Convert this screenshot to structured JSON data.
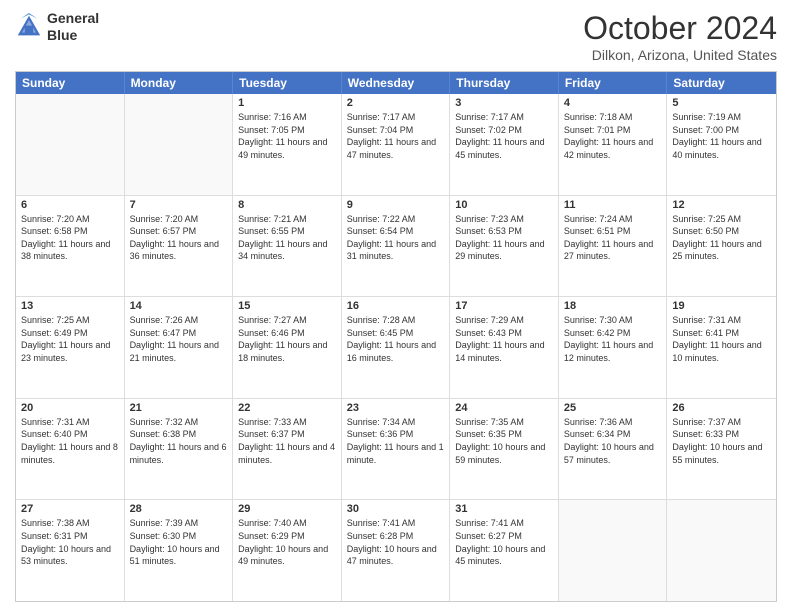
{
  "logo": {
    "line1": "General",
    "line2": "Blue"
  },
  "title": "October 2024",
  "location": "Dilkon, Arizona, United States",
  "days_header": [
    "Sunday",
    "Monday",
    "Tuesday",
    "Wednesday",
    "Thursday",
    "Friday",
    "Saturday"
  ],
  "weeks": [
    [
      {
        "day": "",
        "empty": true
      },
      {
        "day": "",
        "empty": true
      },
      {
        "day": "1",
        "sunrise": "Sunrise: 7:16 AM",
        "sunset": "Sunset: 7:05 PM",
        "daylight": "Daylight: 11 hours and 49 minutes."
      },
      {
        "day": "2",
        "sunrise": "Sunrise: 7:17 AM",
        "sunset": "Sunset: 7:04 PM",
        "daylight": "Daylight: 11 hours and 47 minutes."
      },
      {
        "day": "3",
        "sunrise": "Sunrise: 7:17 AM",
        "sunset": "Sunset: 7:02 PM",
        "daylight": "Daylight: 11 hours and 45 minutes."
      },
      {
        "day": "4",
        "sunrise": "Sunrise: 7:18 AM",
        "sunset": "Sunset: 7:01 PM",
        "daylight": "Daylight: 11 hours and 42 minutes."
      },
      {
        "day": "5",
        "sunrise": "Sunrise: 7:19 AM",
        "sunset": "Sunset: 7:00 PM",
        "daylight": "Daylight: 11 hours and 40 minutes."
      }
    ],
    [
      {
        "day": "6",
        "sunrise": "Sunrise: 7:20 AM",
        "sunset": "Sunset: 6:58 PM",
        "daylight": "Daylight: 11 hours and 38 minutes."
      },
      {
        "day": "7",
        "sunrise": "Sunrise: 7:20 AM",
        "sunset": "Sunset: 6:57 PM",
        "daylight": "Daylight: 11 hours and 36 minutes."
      },
      {
        "day": "8",
        "sunrise": "Sunrise: 7:21 AM",
        "sunset": "Sunset: 6:55 PM",
        "daylight": "Daylight: 11 hours and 34 minutes."
      },
      {
        "day": "9",
        "sunrise": "Sunrise: 7:22 AM",
        "sunset": "Sunset: 6:54 PM",
        "daylight": "Daylight: 11 hours and 31 minutes."
      },
      {
        "day": "10",
        "sunrise": "Sunrise: 7:23 AM",
        "sunset": "Sunset: 6:53 PM",
        "daylight": "Daylight: 11 hours and 29 minutes."
      },
      {
        "day": "11",
        "sunrise": "Sunrise: 7:24 AM",
        "sunset": "Sunset: 6:51 PM",
        "daylight": "Daylight: 11 hours and 27 minutes."
      },
      {
        "day": "12",
        "sunrise": "Sunrise: 7:25 AM",
        "sunset": "Sunset: 6:50 PM",
        "daylight": "Daylight: 11 hours and 25 minutes."
      }
    ],
    [
      {
        "day": "13",
        "sunrise": "Sunrise: 7:25 AM",
        "sunset": "Sunset: 6:49 PM",
        "daylight": "Daylight: 11 hours and 23 minutes."
      },
      {
        "day": "14",
        "sunrise": "Sunrise: 7:26 AM",
        "sunset": "Sunset: 6:47 PM",
        "daylight": "Daylight: 11 hours and 21 minutes."
      },
      {
        "day": "15",
        "sunrise": "Sunrise: 7:27 AM",
        "sunset": "Sunset: 6:46 PM",
        "daylight": "Daylight: 11 hours and 18 minutes."
      },
      {
        "day": "16",
        "sunrise": "Sunrise: 7:28 AM",
        "sunset": "Sunset: 6:45 PM",
        "daylight": "Daylight: 11 hours and 16 minutes."
      },
      {
        "day": "17",
        "sunrise": "Sunrise: 7:29 AM",
        "sunset": "Sunset: 6:43 PM",
        "daylight": "Daylight: 11 hours and 14 minutes."
      },
      {
        "day": "18",
        "sunrise": "Sunrise: 7:30 AM",
        "sunset": "Sunset: 6:42 PM",
        "daylight": "Daylight: 11 hours and 12 minutes."
      },
      {
        "day": "19",
        "sunrise": "Sunrise: 7:31 AM",
        "sunset": "Sunset: 6:41 PM",
        "daylight": "Daylight: 11 hours and 10 minutes."
      }
    ],
    [
      {
        "day": "20",
        "sunrise": "Sunrise: 7:31 AM",
        "sunset": "Sunset: 6:40 PM",
        "daylight": "Daylight: 11 hours and 8 minutes."
      },
      {
        "day": "21",
        "sunrise": "Sunrise: 7:32 AM",
        "sunset": "Sunset: 6:38 PM",
        "daylight": "Daylight: 11 hours and 6 minutes."
      },
      {
        "day": "22",
        "sunrise": "Sunrise: 7:33 AM",
        "sunset": "Sunset: 6:37 PM",
        "daylight": "Daylight: 11 hours and 4 minutes."
      },
      {
        "day": "23",
        "sunrise": "Sunrise: 7:34 AM",
        "sunset": "Sunset: 6:36 PM",
        "daylight": "Daylight: 11 hours and 1 minute."
      },
      {
        "day": "24",
        "sunrise": "Sunrise: 7:35 AM",
        "sunset": "Sunset: 6:35 PM",
        "daylight": "Daylight: 10 hours and 59 minutes."
      },
      {
        "day": "25",
        "sunrise": "Sunrise: 7:36 AM",
        "sunset": "Sunset: 6:34 PM",
        "daylight": "Daylight: 10 hours and 57 minutes."
      },
      {
        "day": "26",
        "sunrise": "Sunrise: 7:37 AM",
        "sunset": "Sunset: 6:33 PM",
        "daylight": "Daylight: 10 hours and 55 minutes."
      }
    ],
    [
      {
        "day": "27",
        "sunrise": "Sunrise: 7:38 AM",
        "sunset": "Sunset: 6:31 PM",
        "daylight": "Daylight: 10 hours and 53 minutes."
      },
      {
        "day": "28",
        "sunrise": "Sunrise: 7:39 AM",
        "sunset": "Sunset: 6:30 PM",
        "daylight": "Daylight: 10 hours and 51 minutes."
      },
      {
        "day": "29",
        "sunrise": "Sunrise: 7:40 AM",
        "sunset": "Sunset: 6:29 PM",
        "daylight": "Daylight: 10 hours and 49 minutes."
      },
      {
        "day": "30",
        "sunrise": "Sunrise: 7:41 AM",
        "sunset": "Sunset: 6:28 PM",
        "daylight": "Daylight: 10 hours and 47 minutes."
      },
      {
        "day": "31",
        "sunrise": "Sunrise: 7:41 AM",
        "sunset": "Sunset: 6:27 PM",
        "daylight": "Daylight: 10 hours and 45 minutes."
      },
      {
        "day": "",
        "empty": true
      },
      {
        "day": "",
        "empty": true
      }
    ]
  ]
}
